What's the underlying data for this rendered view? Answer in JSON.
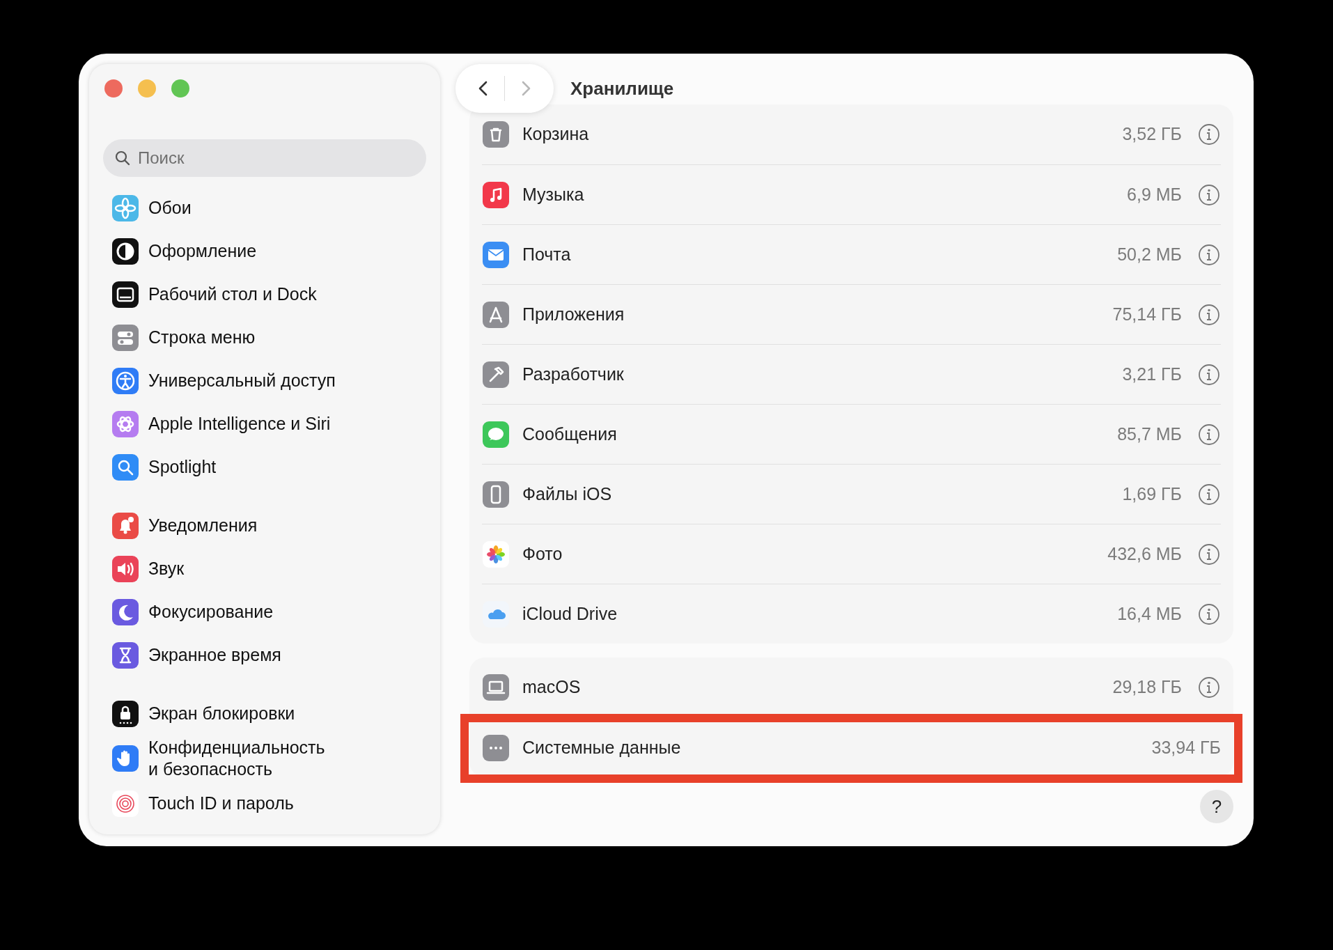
{
  "window": {
    "title": "Хранилище",
    "nav": {
      "back": {
        "disabled": false
      },
      "forward": {
        "disabled": true
      }
    }
  },
  "sidebar": {
    "search": {
      "placeholder": "Поиск"
    },
    "groups": [
      {
        "items": [
          {
            "label": "Обои"
          },
          {
            "label": "Оформление"
          },
          {
            "label": "Рабочий стол и Dock"
          },
          {
            "label": "Строка меню"
          },
          {
            "label": "Универсальный доступ"
          },
          {
            "label": "Apple Intelligence и Siri"
          },
          {
            "label": "Spotlight"
          }
        ]
      },
      {
        "items": [
          {
            "label": "Уведомления"
          },
          {
            "label": "Звук"
          },
          {
            "label": "Фокусирование"
          },
          {
            "label": "Экранное время"
          }
        ]
      },
      {
        "items": [
          {
            "label": "Экран блокировки"
          },
          {
            "label": "Конфиденциальность\nи безопасность"
          },
          {
            "label": "Touch ID и пароль"
          }
        ]
      }
    ]
  },
  "storage": {
    "groups": [
      {
        "rows": [
          {
            "name": "Корзина",
            "size": "3,52 ГБ",
            "info": true,
            "highlighted": false
          },
          {
            "name": "Музыка",
            "size": "6,9 МБ",
            "info": true,
            "highlighted": false
          },
          {
            "name": "Почта",
            "size": "50,2 МБ",
            "info": true,
            "highlighted": false
          },
          {
            "name": "Приложения",
            "size": "75,14 ГБ",
            "info": true,
            "highlighted": false
          },
          {
            "name": "Разработчик",
            "size": "3,21 ГБ",
            "info": true,
            "highlighted": false
          },
          {
            "name": "Сообщения",
            "size": "85,7 МБ",
            "info": true,
            "highlighted": false
          },
          {
            "name": "Файлы iOS",
            "size": "1,69 ГБ",
            "info": true,
            "highlighted": false
          },
          {
            "name": "Фото",
            "size": "432,6 МБ",
            "info": true,
            "highlighted": false
          },
          {
            "name": "iCloud Drive",
            "size": "16,4 МБ",
            "info": true,
            "highlighted": false
          }
        ]
      },
      {
        "rows": [
          {
            "name": "macOS",
            "size": "29,18 ГБ",
            "info": true,
            "highlighted": false
          },
          {
            "name": "Системные данные",
            "size": "33,94 ГБ",
            "info": false,
            "highlighted": true
          }
        ]
      }
    ]
  },
  "help_button": {
    "label": "?"
  }
}
